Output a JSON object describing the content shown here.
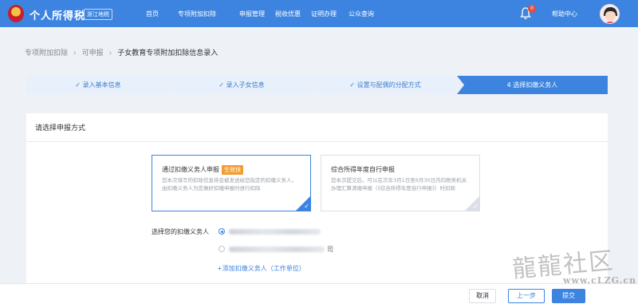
{
  "header": {
    "app_title": "个人所得税",
    "region": "浙江地税",
    "nav": [
      "首页",
      "专项附加扣除",
      "申报管理",
      "税收优惠",
      "证明办理",
      "公众查询"
    ],
    "notification_count": "0",
    "help": "帮助中心"
  },
  "breadcrumb": [
    "专项附加扣除",
    "可申报",
    "子女教育专项附加扣除信息录入"
  ],
  "steps": [
    {
      "label": "录入基本信息",
      "status": "done"
    },
    {
      "label": "录入子女信息",
      "status": "done"
    },
    {
      "label": "设置与配偶的分配方式",
      "status": "done"
    },
    {
      "label": "4 选择扣缴义务人",
      "status": "active"
    }
  ],
  "main": {
    "section_title": "请选择申报方式",
    "options": [
      {
        "title": "通过扣缴义务人申报",
        "tag": "生效快",
        "description": "您本次填写的扣除信息将会被发送给您指定的扣缴义务人，由扣缴义务人为您做好扣缴申报时进行扣除",
        "selected": true
      },
      {
        "title": "综合所得年度自行申报",
        "tag": "",
        "description": "您本次提交后，可以在次年3月1日至6月30日内向税务机关办理汇算清缴申报（《综合所得年度自行申报》）时扣除",
        "selected": false
      }
    ],
    "agent_label": "选择您的扣缴义务人",
    "agents": [
      {
        "visible_text": "",
        "selected": true
      },
      {
        "visible_text": "司",
        "selected": false
      }
    ],
    "add_agent": "+添加扣缴义务人（工作单位）"
  },
  "actions": {
    "cancel": "取消",
    "prev": "上一步",
    "submit": "提交"
  },
  "watermark": {
    "chinese": "龍龍社区",
    "url": "www.cLZG.cn"
  },
  "colors": {
    "primary": "#3d84e0",
    "tag": "#f39c34",
    "step_bg": "#e7f0fb",
    "step_active": "#3d84e0"
  }
}
